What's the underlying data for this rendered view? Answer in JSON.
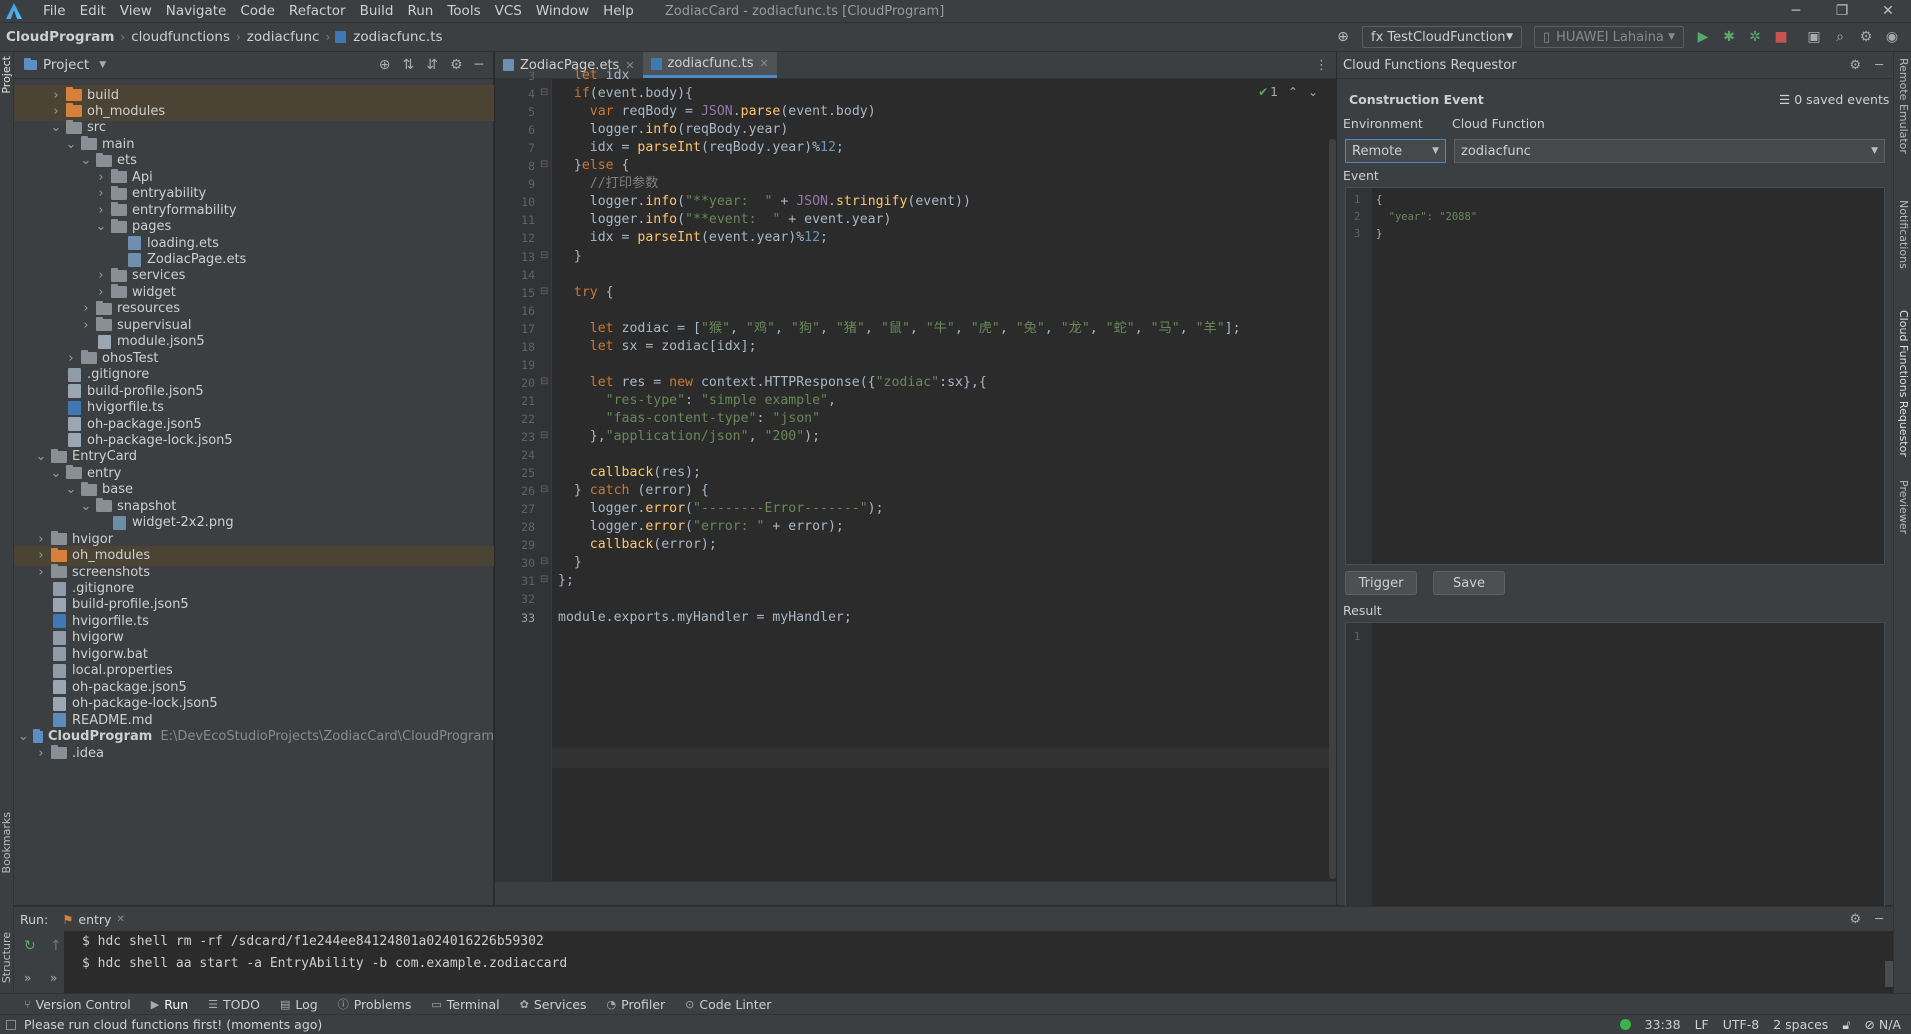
{
  "menu": [
    "File",
    "Edit",
    "View",
    "Navigate",
    "Code",
    "Refactor",
    "Build",
    "Run",
    "Tools",
    "VCS",
    "Window",
    "Help"
  ],
  "window_title": "ZodiacCard - zodiacfunc.ts [CloudProgram]",
  "breadcrumbs": [
    "CloudProgram",
    "cloudfunctions",
    "zodiacfunc",
    "zodiacfunc.ts"
  ],
  "toolbar": {
    "run_config": "fx  TestCloudFunction",
    "device": "HUAWEI Lahaina"
  },
  "project": {
    "title": "Project",
    "rows": [
      {
        "label": "build",
        "depth": 2,
        "kind": "folder",
        "color": "orange",
        "arrow": "right",
        "hl": true
      },
      {
        "label": "oh_modules",
        "depth": 2,
        "kind": "folder",
        "color": "orange",
        "arrow": "right",
        "hl": true
      },
      {
        "label": "src",
        "depth": 2,
        "kind": "folder",
        "color": "grey",
        "arrow": "down"
      },
      {
        "label": "main",
        "depth": 3,
        "kind": "folder",
        "color": "grey",
        "arrow": "down"
      },
      {
        "label": "ets",
        "depth": 4,
        "kind": "folder",
        "color": "grey",
        "arrow": "down"
      },
      {
        "label": "Api",
        "depth": 5,
        "kind": "folder",
        "color": "grey",
        "arrow": "right"
      },
      {
        "label": "entryability",
        "depth": 5,
        "kind": "folder",
        "color": "grey",
        "arrow": "right"
      },
      {
        "label": "entryformability",
        "depth": 5,
        "kind": "folder",
        "color": "grey",
        "arrow": "right"
      },
      {
        "label": "pages",
        "depth": 5,
        "kind": "folder",
        "color": "grey",
        "arrow": "down"
      },
      {
        "label": "loading.ets",
        "depth": 6,
        "kind": "ets"
      },
      {
        "label": "ZodiacPage.ets",
        "depth": 6,
        "kind": "ets"
      },
      {
        "label": "services",
        "depth": 5,
        "kind": "folder",
        "color": "grey",
        "arrow": "right"
      },
      {
        "label": "widget",
        "depth": 5,
        "kind": "folder",
        "color": "grey",
        "arrow": "right"
      },
      {
        "label": "resources",
        "depth": 4,
        "kind": "folder",
        "color": "grey",
        "arrow": "right"
      },
      {
        "label": "supervisual",
        "depth": 4,
        "kind": "folder",
        "color": "grey",
        "arrow": "right"
      },
      {
        "label": "module.json5",
        "depth": 4,
        "kind": "json"
      },
      {
        "label": "ohosTest",
        "depth": 3,
        "kind": "folder",
        "color": "grey",
        "arrow": "right"
      },
      {
        "label": ".gitignore",
        "depth": 2,
        "kind": "file"
      },
      {
        "label": "build-profile.json5",
        "depth": 2,
        "kind": "json"
      },
      {
        "label": "hvigorfile.ts",
        "depth": 2,
        "kind": "ts"
      },
      {
        "label": "oh-package.json5",
        "depth": 2,
        "kind": "json"
      },
      {
        "label": "oh-package-lock.json5",
        "depth": 2,
        "kind": "json"
      },
      {
        "label": "EntryCard",
        "depth": 1,
        "kind": "folder",
        "color": "grey",
        "arrow": "down"
      },
      {
        "label": "entry",
        "depth": 2,
        "kind": "folder",
        "color": "grey",
        "arrow": "down"
      },
      {
        "label": "base",
        "depth": 3,
        "kind": "folder",
        "color": "grey",
        "arrow": "down"
      },
      {
        "label": "snapshot",
        "depth": 4,
        "kind": "folder",
        "color": "grey",
        "arrow": "down"
      },
      {
        "label": "widget-2x2.png",
        "depth": 5,
        "kind": "png"
      },
      {
        "label": "hvigor",
        "depth": 1,
        "kind": "folder",
        "color": "grey",
        "arrow": "right"
      },
      {
        "label": "oh_modules",
        "depth": 1,
        "kind": "folder",
        "color": "orange",
        "arrow": "right",
        "hl": true
      },
      {
        "label": "screenshots",
        "depth": 1,
        "kind": "folder",
        "color": "grey",
        "arrow": "right"
      },
      {
        "label": ".gitignore",
        "depth": 1,
        "kind": "file"
      },
      {
        "label": "build-profile.json5",
        "depth": 1,
        "kind": "json"
      },
      {
        "label": "hvigorfile.ts",
        "depth": 1,
        "kind": "ts"
      },
      {
        "label": "hvigorw",
        "depth": 1,
        "kind": "file"
      },
      {
        "label": "hvigorw.bat",
        "depth": 1,
        "kind": "file"
      },
      {
        "label": "local.properties",
        "depth": 1,
        "kind": "file"
      },
      {
        "label": "oh-package.json5",
        "depth": 1,
        "kind": "json"
      },
      {
        "label": "oh-package-lock.json5",
        "depth": 1,
        "kind": "json"
      },
      {
        "label": "README.md",
        "depth": 1,
        "kind": "md"
      },
      {
        "label": "CloudProgram",
        "depth": 0,
        "kind": "folder",
        "color": "blue",
        "arrow": "down",
        "bold": true,
        "path": "E:\\DevEcoStudioProjects\\ZodiacCard\\CloudProgram"
      },
      {
        "label": ".idea",
        "depth": 1,
        "kind": "folder",
        "color": "grey",
        "arrow": "right"
      }
    ]
  },
  "editor": {
    "tabs": [
      {
        "label": "ZodiacPage.ets",
        "active": false
      },
      {
        "label": "zodiacfunc.ts",
        "active": true
      }
    ],
    "inspection": "1",
    "current_line": 33,
    "lines": [
      {
        "n": 3,
        "html": "<span class='k'>  let </span>idx"
      },
      {
        "n": 4,
        "html": "  <span class='k'>if</span>(event.body){"
      },
      {
        "n": 5,
        "html": "    <span class='k'>var </span>reqBody = <span class='m'>JSON</span>.<span class='f'>parse</span>(event.body)"
      },
      {
        "n": 6,
        "html": "    logger.<span class='f'>info</span>(reqBody.year)"
      },
      {
        "n": 7,
        "html": "    idx = <span class='f'>parseInt</span>(reqBody.year)%<span class='n'>12</span>;"
      },
      {
        "n": 8,
        "html": "  }<span class='k'>else </span>{"
      },
      {
        "n": 9,
        "html": "    <span class='c'>//打印参数</span>"
      },
      {
        "n": 10,
        "html": "    logger.<span class='f'>info</span>(<span class='s'>\"**year:  \"</span> + <span class='m'>JSON</span>.<span class='f'>stringify</span>(event))"
      },
      {
        "n": 11,
        "html": "    logger.<span class='f'>info</span>(<span class='s'>\"**event:  \"</span> + event.year)"
      },
      {
        "n": 12,
        "html": "    idx = <span class='f'>parseInt</span>(event.year)%<span class='n'>12</span>;"
      },
      {
        "n": 13,
        "html": "  }"
      },
      {
        "n": 14,
        "html": ""
      },
      {
        "n": 15,
        "html": "  <span class='k'>try </span>{"
      },
      {
        "n": 16,
        "html": ""
      },
      {
        "n": 17,
        "html": "    <span class='k'>let </span>zodiac = [<span class='s'>\"猴\"</span>, <span class='s'>\"鸡\"</span>, <span class='s'>\"狗\"</span>, <span class='s'>\"猪\"</span>, <span class='s'>\"鼠\"</span>, <span class='s'>\"牛\"</span>, <span class='s'>\"虎\"</span>, <span class='s'>\"兔\"</span>, <span class='s'>\"龙\"</span>, <span class='s'>\"蛇\"</span>, <span class='s'>\"马\"</span>, <span class='s'>\"羊\"</span>];"
      },
      {
        "n": 18,
        "html": "    <span class='k'>let </span>sx = zodiac[idx];"
      },
      {
        "n": 19,
        "html": ""
      },
      {
        "n": 20,
        "html": "    <span class='k'>let </span>res = <span class='k'>new </span>context.HTTPResponse({<span class='s'>\"zodiac\"</span>:sx},{"
      },
      {
        "n": 21,
        "html": "      <span class='s'>\"res-type\"</span>: <span class='s'>\"simple example\"</span>,"
      },
      {
        "n": 22,
        "html": "      <span class='s'>\"faas-content-type\"</span>: <span class='s'>\"json\"</span>"
      },
      {
        "n": 23,
        "html": "    },<span class='s'>\"application/json\"</span>, <span class='s'>\"200\"</span>);"
      },
      {
        "n": 24,
        "html": ""
      },
      {
        "n": 25,
        "html": "    <span class='f'>callback</span>(res);"
      },
      {
        "n": 26,
        "html": "  } <span class='k'>catch </span>(error) {"
      },
      {
        "n": 27,
        "html": "    logger.<span class='f'>error</span>(<span class='s'>\"--------Error-------\"</span>);"
      },
      {
        "n": 28,
        "html": "    logger.<span class='f'>error</span>(<span class='s'>\"error: \"</span> + error);"
      },
      {
        "n": 29,
        "html": "    <span class='f'>callback</span>(error);"
      },
      {
        "n": 30,
        "html": "  }"
      },
      {
        "n": 31,
        "html": "};"
      },
      {
        "n": 32,
        "html": ""
      },
      {
        "n": 33,
        "html": "module.exports.myHandler = myHandler;"
      }
    ]
  },
  "requestor": {
    "title": "Cloud Functions Requestor",
    "section": "Construction Event",
    "saved_events": "0 saved events",
    "env_label": "Environment",
    "fn_label": "Cloud Function",
    "env_value": "Remote",
    "fn_value": "zodiacfunc",
    "event_label": "Event",
    "event_lines": [
      {
        "n": "1",
        "t": "{"
      },
      {
        "n": "2",
        "t": "  \"year\": \"2088\""
      },
      {
        "n": "3",
        "t": "}"
      }
    ],
    "trigger": "Trigger",
    "save": "Save",
    "result_label": "Result",
    "result_line": "1"
  },
  "run": {
    "label": "Run:",
    "tab": "entry",
    "lines": [
      "$ hdc shell rm -rf /sdcard/f1e244ee84124801a024016226b59302",
      "$ hdc shell aa start -a EntryAbility -b com.example.zodiaccard"
    ]
  },
  "bottom_tools": [
    {
      "label": "Version Control",
      "icon": "branch-icon"
    },
    {
      "label": "Run",
      "icon": "play-icon",
      "active": true
    },
    {
      "label": "TODO",
      "icon": "list-icon"
    },
    {
      "label": "Log",
      "icon": "log-icon"
    },
    {
      "label": "Problems",
      "icon": "info-icon"
    },
    {
      "label": "Terminal",
      "icon": "terminal-icon"
    },
    {
      "label": "Services",
      "icon": "services-icon"
    },
    {
      "label": "Profiler",
      "icon": "profiler-icon"
    },
    {
      "label": "Code Linter",
      "icon": "linter-icon"
    }
  ],
  "status": {
    "message": "Please run cloud functions first! (moments ago)",
    "position": "33:38",
    "line_sep": "LF",
    "encoding": "UTF-8",
    "indent": "2 spaces",
    "extra": "N/A"
  },
  "side_labels": {
    "project": "Project",
    "bookmarks": "Bookmarks",
    "structure": "Structure",
    "remote": "Remote Emulator",
    "notifications": "Notifications",
    "cfr": "Cloud Functions Requestor",
    "previewer": "Previewer"
  }
}
